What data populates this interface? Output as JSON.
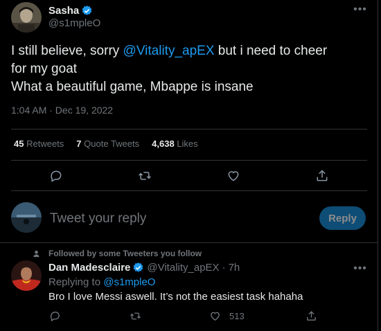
{
  "tweet": {
    "author_name": "Sasha",
    "author_handle": "@s1mpleO",
    "text_part1": "I still believe, sorry ",
    "mention": "@Vitality_apEX",
    "text_part2": " but i need to cheer",
    "text_line2": "for my goat",
    "text_line3": "What a beautiful game, Mbappe is insane",
    "timestamp": "1:04 AM · Dec 19, 2022"
  },
  "stats": {
    "retweets_count": "45",
    "retweets_label": "Retweets",
    "quotes_count": "7",
    "quotes_label": "Quote Tweets",
    "likes_count": "4,638",
    "likes_label": "Likes"
  },
  "composer": {
    "placeholder": "Tweet your reply",
    "reply_label": "Reply"
  },
  "reply": {
    "context": "Followed by some Tweeters you follow",
    "author_name": "Dan Madesclaire",
    "author_handle": "@Vitality_apEX",
    "separator": "·",
    "time": "7h",
    "replying_prefix": "Replying to",
    "replying_handle": "@s1mpleO",
    "text": "Bro I love Messi aswell. It’s not the easiest task hahaha",
    "like_count": "513"
  },
  "icons": [
    "verified-badge-icon",
    "more-icon",
    "reply-icon",
    "retweet-icon",
    "like-icon",
    "share-icon",
    "person-icon"
  ],
  "colors": {
    "background": "#000000",
    "text": "#e7e9ea",
    "muted": "#71767b",
    "accent": "#1d9bf0",
    "divider": "#2f3336"
  }
}
